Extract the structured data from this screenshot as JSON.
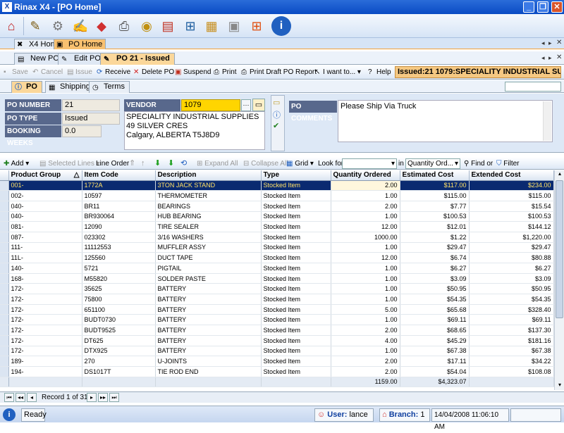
{
  "window": {
    "title": "Rinax X4 - [PO Home]",
    "controls": [
      "_",
      "❐",
      "✕"
    ]
  },
  "toolbar": {
    "icons": [
      "home-icon",
      "edit-icon",
      "tools-icon",
      "notepad-icon",
      "cube-icon",
      "print-icon",
      "coins-icon",
      "cash-icon",
      "network-icon",
      "document-icon",
      "archive-icon",
      "windows-icon",
      "info-icon"
    ]
  },
  "doc_tabs": [
    {
      "label": "X4 Home"
    },
    {
      "label": "PO Home"
    }
  ],
  "main_tabs": [
    {
      "label": "New PO"
    },
    {
      "label": "Edit PO"
    },
    {
      "label": "PO 21 - Issued"
    }
  ],
  "actions": {
    "save": "Save",
    "cancel": "Cancel",
    "issue": "Issue",
    "receive": "Receive",
    "delete": "Delete PO",
    "suspend": "Suspend",
    "print": "Print",
    "print_draft": "Print Draft PO Report",
    "iwant": "I want to...",
    "help": "Help"
  },
  "status_header": "Issued:21 1079:SPECIALITY INDUSTRIAL SUP...",
  "sub_tabs": [
    {
      "label": "PO"
    },
    {
      "label": "Shipping"
    },
    {
      "label": "Terms"
    }
  ],
  "po": {
    "number_label": "PO NUMBER",
    "number": "21",
    "type_label": "PO TYPE",
    "type": "Issued",
    "weeks_label": "BOOKING WEEKS",
    "weeks": "0.0",
    "vendor_label": "VENDOR",
    "vendor_code": "1079",
    "vendor_address": [
      "SPECIALITY INDUSTRIAL SUPPLIES",
      "49 SILVER CRES",
      "Calgary, ALBERTA  T5J8D9"
    ],
    "comments_label": "PO COMMENTS",
    "comments": "Please Ship Via Truck"
  },
  "grid_toolbar": {
    "add": "Add",
    "selected_lines": "Selected Lines",
    "line_order": "Line Order",
    "expand_all": "Expand All",
    "collapse_all": "Collapse All",
    "grid": "Grid",
    "look_for": "Look for",
    "in": "in",
    "in_value": "Quantity Ord...",
    "find_or": "Find or",
    "filter": "Filter"
  },
  "grid": {
    "columns": [
      "Product Group",
      "Item Code",
      "Description",
      "Type",
      "Quantity Ordered",
      "Estimated Cost",
      "Extended Cost"
    ],
    "sort_indicator": "△",
    "rows": [
      [
        "001-",
        "1772A",
        "3TON JACK STAND",
        "Stocked Item",
        "2.00",
        "$117.00",
        "$234.00"
      ],
      [
        "002-",
        "10597",
        "THERMOMETER",
        "Stocked Item",
        "1.00",
        "$115.00",
        "$115.00"
      ],
      [
        "040-",
        "BR11",
        "BEARINGS",
        "Stocked Item",
        "2.00",
        "$7.77",
        "$15.54"
      ],
      [
        "040-",
        "BR930064",
        "HUB BEARING",
        "Stocked Item",
        "1.00",
        "$100.53",
        "$100.53"
      ],
      [
        "081-",
        "12090",
        "TIRE SEALER",
        "Stocked Item",
        "12.00",
        "$12.01",
        "$144.12"
      ],
      [
        "087-",
        "023302",
        "3/16 WASHERS",
        "Stocked Item",
        "1000.00",
        "$1.22",
        "$1,220.00"
      ],
      [
        "111-",
        "11112553",
        "MUFFLER ASSY",
        "Stocked Item",
        "1.00",
        "$29.47",
        "$29.47"
      ],
      [
        "11L-",
        "125560",
        "DUCT TAPE",
        "Stocked Item",
        "12.00",
        "$6.74",
        "$80.88"
      ],
      [
        "140-",
        "5721",
        "PIGTAIL",
        "Stocked Item",
        "1.00",
        "$6.27",
        "$6.27"
      ],
      [
        "168-",
        "M55820",
        "SOLDER PASTE",
        "Stocked Item",
        "1.00",
        "$3.09",
        "$3.09"
      ],
      [
        "172-",
        "35625",
        "BATTERY",
        "Stocked Item",
        "1.00",
        "$50.95",
        "$50.95"
      ],
      [
        "172-",
        "75800",
        "BATTERY",
        "Stocked Item",
        "1.00",
        "$54.35",
        "$54.35"
      ],
      [
        "172-",
        "651100",
        "BATTERY",
        "Stocked Item",
        "5.00",
        "$65.68",
        "$328.40"
      ],
      [
        "172-",
        "BUDT0730",
        "BATTERY",
        "Stocked Item",
        "1.00",
        "$69.11",
        "$69.11"
      ],
      [
        "172-",
        "BUDT9525",
        "BATTERY",
        "Stocked Item",
        "2.00",
        "$68.65",
        "$137.30"
      ],
      [
        "172-",
        "DT625",
        "BATTERY",
        "Stocked Item",
        "4.00",
        "$45.29",
        "$181.16"
      ],
      [
        "172-",
        "DTX925",
        "BATTERY",
        "Stocked Item",
        "1.00",
        "$67.38",
        "$67.38"
      ],
      [
        "189-",
        "270",
        "U-JOINTS",
        "Stocked Item",
        "2.00",
        "$17.11",
        "$34.22"
      ],
      [
        "194-",
        "DS1017T",
        "TIE ROD END",
        "Stocked Item",
        "2.00",
        "$54.04",
        "$108.08"
      ]
    ],
    "totals": {
      "quantity": "1159.00",
      "estimated": "$4,323.07"
    }
  },
  "nav": {
    "record": "Record 1 of 31"
  },
  "statusbar": {
    "ready": "Ready",
    "user_label": "User:",
    "user": "lance",
    "branch_label": "Branch:",
    "branch": "1",
    "datetime": "14/04/2008 11:06:10 AM"
  }
}
